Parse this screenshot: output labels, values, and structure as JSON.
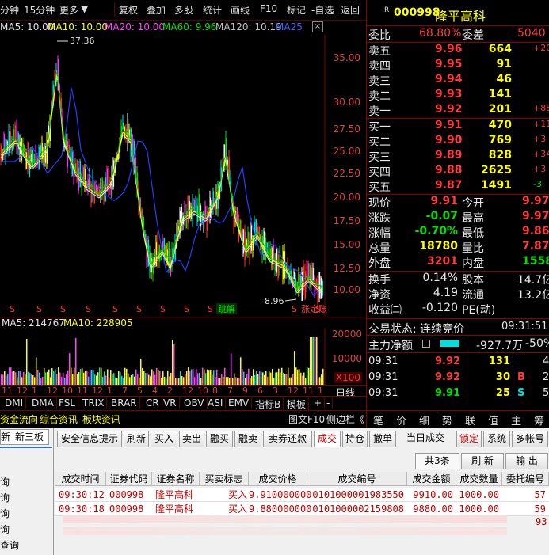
{
  "toolbar": {
    "period1": "分钟",
    "period2": "15分钟",
    "more": "更多",
    "restore": "复权",
    "overlay": "叠加",
    "multi": "多股",
    "stats": "统计",
    "draw": "画线",
    "f10": "F10",
    "mark": "标记",
    "watch": "-自选",
    "back": "返回"
  },
  "ma": {
    "ma5": "MA5: 10.00",
    "ma10": "MA10: 10.00",
    "ma20": "MA20: 10.00",
    "ma60": "MA60: 9.96",
    "ma120": "MA120: 10.19",
    "ma250": "MA25"
  },
  "price_axis": [
    "35.00",
    "30.00",
    "27.50",
    "25.00",
    "22.50",
    "20.00",
    "17.50",
    "15.00",
    "12.50",
    "10.00"
  ],
  "chart_notes": {
    "high": "37.36",
    "low": "8.96",
    "tag1": "跳解",
    "tag2": "涨定账"
  },
  "vol_ma": {
    "ma5": "MA5: 214767",
    "ma10": "MA10: 228905"
  },
  "vol_axis": [
    "20000",
    "10000",
    "X100"
  ],
  "date_ticks": [
    "11",
    "12",
    "1",
    "12",
    "10",
    "11",
    "12",
    "1",
    "7",
    "5",
    "4",
    "2",
    "12",
    "10",
    "8",
    "7",
    "9",
    "6",
    "3",
    "12",
    "11",
    "1"
  ],
  "date_label": "日线",
  "indicator_tabs": [
    "DMI",
    "DMA",
    "FSL",
    "TRIX",
    "BRAR",
    "CR",
    "VR",
    "OBV",
    "ASI",
    "EMV",
    "指标B",
    "模板",
    "+",
    "-"
  ],
  "bottom_tabs": {
    "fund": "资金流向",
    "news": "综合资讯",
    "sector": "板块资讯",
    "f10": "图文F10",
    "side": "侧边栏《"
  },
  "right_tabs": [
    "笔",
    "价",
    "细",
    "势",
    "联",
    "值",
    "主",
    "筹"
  ],
  "stock": {
    "code": "000998",
    "name": "隆平高科",
    "wb_label": "委比",
    "wb": "68.80%",
    "wc_label": "委差",
    "wc": "5040"
  },
  "asks": [
    {
      "label": "卖五",
      "price": "9.96",
      "vol": "664",
      "chg": "+20"
    },
    {
      "label": "卖四",
      "price": "9.95",
      "vol": "91",
      "chg": ""
    },
    {
      "label": "卖三",
      "price": "9.94",
      "vol": "46",
      "chg": ""
    },
    {
      "label": "卖二",
      "price": "9.93",
      "vol": "141",
      "chg": ""
    },
    {
      "label": "卖一",
      "price": "9.92",
      "vol": "201",
      "chg": "+88"
    }
  ],
  "bids": [
    {
      "label": "买一",
      "price": "9.91",
      "vol": "470",
      "chg": "+11"
    },
    {
      "label": "买二",
      "price": "9.90",
      "vol": "769",
      "chg": "+3"
    },
    {
      "label": "买三",
      "price": "9.89",
      "vol": "828",
      "chg": "+34"
    },
    {
      "label": "买四",
      "price": "9.88",
      "vol": "2625",
      "chg": "+3"
    },
    {
      "label": "买五",
      "price": "9.87",
      "vol": "1491",
      "chg": "-3"
    }
  ],
  "quote": [
    {
      "l1": "现价",
      "v1": "9.91",
      "l2": "今开",
      "v2": "9.97"
    },
    {
      "l1": "涨跌",
      "v1": "-0.07",
      "l2": "最高",
      "v2": "9.97"
    },
    {
      "l1": "涨幅",
      "v1": "-0.70%",
      "l2": "最低",
      "v2": "9.86"
    },
    {
      "l1": "总量",
      "v1": "18780",
      "l2": "量比",
      "v2": "7.87"
    },
    {
      "l1": "外盘",
      "v1": "3201",
      "l2": "内盘",
      "v2": "15587"
    }
  ],
  "info": [
    {
      "l1": "换手",
      "v1": "0.14%",
      "l2": "股本",
      "v2": "14.7亿"
    },
    {
      "l1": "净资",
      "v1": "4.19",
      "l2": "流通",
      "v2": "13.2亿"
    },
    {
      "l1": "收益㈡",
      "v1": "-0.120",
      "l2": "PE(动)",
      "v2": ""
    }
  ],
  "trade_status": "交易状态: 连续竞价",
  "trade_time": "09:31:51",
  "main_flow_label": "主力净额",
  "main_flow_value": "-927.7万",
  "main_flow_pct": "-50%",
  "ticks": [
    {
      "time": "09:31",
      "price": "9.92",
      "vol": "131",
      "flag": "",
      "extra": "4"
    },
    {
      "time": "09:31",
      "price": "9.92",
      "vol": "30",
      "flag": "B",
      "extra": "2"
    },
    {
      "time": "09:31",
      "price": "9.91",
      "vol": "25",
      "flag": "S",
      "extra": "5"
    }
  ],
  "trade": {
    "left_tabs": [
      "新",
      "新三板"
    ],
    "left_items": [
      "询",
      "询",
      "询",
      "询",
      "查询"
    ],
    "buttons": [
      "安全信息提示",
      "刷新",
      "买入",
      "卖出",
      "融买",
      "融卖",
      "卖券还款",
      "成交",
      "持仓",
      "撤单",
      "当日成交",
      "锁定",
      "系统",
      "多帐号"
    ],
    "count": "共3条",
    "refresh": "刷 新",
    "export": "输 出",
    "headers": [
      "成交时间",
      "证券代码",
      "证券名称",
      "买卖标志",
      "成交价格",
      "成交编号",
      "成交金额",
      "成交数量",
      "委托编号"
    ],
    "rows": [
      [
        "09:30:12",
        "000998",
        "隆平高科",
        "买入",
        "9.910000000",
        "0101000001983550",
        "9910.00",
        "1000.00",
        "57"
      ],
      [
        "09:30:18",
        "000998",
        "隆平高科",
        "买入",
        "9.880000000",
        "0101000002159808",
        "9880.00",
        "1000.00",
        "59"
      ]
    ],
    "extra_cell": "93"
  }
}
